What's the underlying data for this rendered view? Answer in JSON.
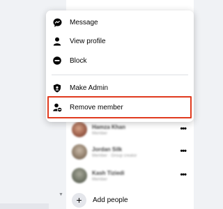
{
  "menu": {
    "items": [
      {
        "label": "Message",
        "icon": "messenger-icon"
      },
      {
        "label": "View profile",
        "icon": "person-icon"
      },
      {
        "label": "Block",
        "icon": "block-icon"
      },
      {
        "label": "Make Admin",
        "icon": "shield-icon"
      },
      {
        "label": "Remove member",
        "icon": "remove-member-icon"
      }
    ]
  },
  "members": [
    {
      "name": "Hamza Khan",
      "role": "Member"
    },
    {
      "name": "Jordan Silk",
      "role": "Member · Group creator"
    },
    {
      "name": "Kash Tiziedi",
      "role": "Member"
    }
  ],
  "add_people": {
    "label": "Add people",
    "icon": "plus-icon"
  },
  "colors": {
    "highlight": "#e03a1e",
    "menu_bg": "#ffffff",
    "page_bg": "#f0f2f5"
  }
}
